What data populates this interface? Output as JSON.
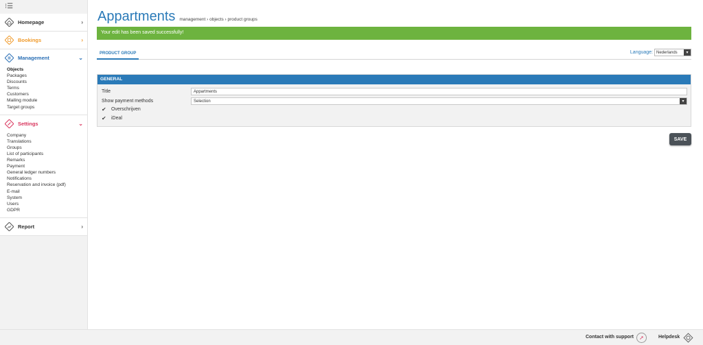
{
  "sidebar": {
    "toggle_icon": "menu-toggle-icon",
    "sections": {
      "homepage": {
        "label": "Homepage",
        "color": "#333333"
      },
      "bookings": {
        "label": "Bookings",
        "color": "#f09a2a"
      },
      "management": {
        "label": "Management",
        "color": "#2a6fb5",
        "items": [
          "Objects",
          "Packages",
          "Discounts",
          "Terms",
          "Customers",
          "Mailing module",
          "Target groups"
        ],
        "active": "Objects"
      },
      "settings": {
        "label": "Settings",
        "color": "#d9365e",
        "items": [
          "Company",
          "Translations",
          "Groups",
          "List of participants",
          "Remarks",
          "Payment",
          "General ledger numbers",
          "Notifications",
          "Reservation and invoice (pdf)",
          "E-mail",
          "System",
          "Users",
          "GDPR"
        ]
      },
      "report": {
        "label": "Report",
        "color": "#333333"
      }
    }
  },
  "header": {
    "title": "Appartments",
    "breadcrumb": "management › objects › product groups"
  },
  "alert": {
    "text": "Your edit has been saved successfully!",
    "color": "#6db33f"
  },
  "tabs": {
    "active": "PRODUCT GROUP"
  },
  "language": {
    "label": "Language:",
    "selected": "Nederlands"
  },
  "panel": {
    "title": "GENERAL",
    "title_field": {
      "label": "Title",
      "value": "Appartments"
    },
    "payment_field": {
      "label": "Show payment methods",
      "selected": "Selection"
    },
    "checkboxes": [
      {
        "label": "Overschrijven",
        "checked": true
      },
      {
        "label": "iDeal",
        "checked": true
      }
    ]
  },
  "save_label": "SAVE",
  "footer": {
    "support": "Contact with support",
    "helpdesk": "Helpdesk"
  },
  "accent_color": "#2a7ab8"
}
